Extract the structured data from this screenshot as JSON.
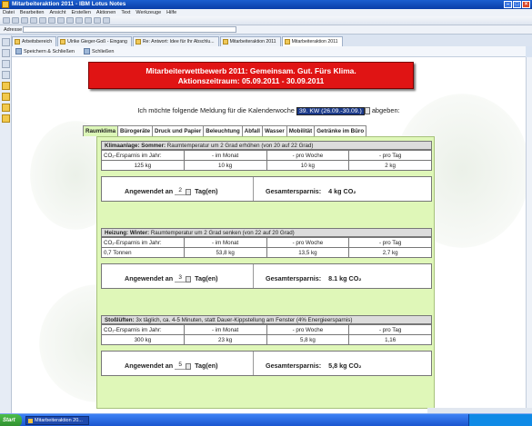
{
  "window": {
    "title": "Mitarbeiteraktion 2011 - IBM Lotus Notes"
  },
  "menu": [
    "Datei",
    "Bearbeiten",
    "Ansicht",
    "Erstellen",
    "Aktionen",
    "Text",
    "Werkzeuge",
    "Hilfe"
  ],
  "address": {
    "label": "Adresse"
  },
  "tabs": [
    {
      "label": "Arbeitsbereich"
    },
    {
      "label": "Ulrike Gieger-Goß - Eingang"
    },
    {
      "label": "Re: Antwort: Idee für Ihr Abschlu..."
    },
    {
      "label": "Mitarbeiteraktion 2011"
    },
    {
      "label": "Mitarbeiteraktion 2011"
    }
  ],
  "actions": {
    "save_close": "Speichern & Schließen",
    "close": "Schließen"
  },
  "banner": {
    "line1": "Mitarbeiterwettbewerb 2011: Gemeinsam. Gut. Fürs Klima.",
    "line2": "Aktionszeitraum: 05.09.2011 - 30.09.2011"
  },
  "week": {
    "prefix": "Ich möchte folgende Meldung für die Kalenderwoche",
    "selected": "39. KW (26.09.-30.09.)",
    "suffix": "abgeben:"
  },
  "categories": [
    "Raumklima",
    "Bürogeräte",
    "Druck und Papier",
    "Beleuchtung",
    "Abfall",
    "Wasser",
    "Mobilität",
    "Getränke im Büro"
  ],
  "sections": [
    {
      "title": "Klimaanlage: Sommer:",
      "desc": "Raumtemperatur um 2 Grad erhöhen (von 20 auf 22 Grad)",
      "row1": [
        "CO₂-Ersparnis im Jahr:",
        "- im Monat",
        "- pro Woche",
        "- pro Tag"
      ],
      "row2": [
        "125 kg",
        "10 kg",
        "10 kg",
        "2 kg"
      ],
      "applied_label": "Angewendet an",
      "days": "2",
      "days_unit": "Tag(en)",
      "total_label": "Gesamtersparnis:",
      "total": "4 kg CO₂"
    },
    {
      "title": "Heizung: Winter:",
      "desc": "Raumtemperatur um 2 Grad senken (von 22 auf 20 Grad)",
      "row1": [
        "CO₂-Ersparnis im Jahr:",
        "- im Monat",
        "- pro Woche",
        "- pro Tag"
      ],
      "row2": [
        "0,7 Tonnen",
        "53,8 kg",
        "13,5 kg",
        "2,7 kg"
      ],
      "applied_label": "Angewendet an",
      "days": "3",
      "days_unit": "Tag(en)",
      "total_label": "Gesamtersparnis:",
      "total": "8.1 kg CO₂"
    },
    {
      "title": "Stoßlüften:",
      "desc": "3x täglich, ca. 4-5 Minuten, statt Dauer-Kippstellung am Fenster (4% Energieersparnis)",
      "row1": [
        "CO₂-Ersparnis im Jahr:",
        "- im Monat",
        "- pro Woche",
        "- pro Tag"
      ],
      "row2": [
        "300 kg",
        "23 kg",
        "5,8 kg",
        "1,16"
      ],
      "applied_label": "Angewendet an",
      "days": "5",
      "days_unit": "Tag(en)",
      "total_label": "Gesamtersparnis:",
      "total": "5,8 kg CO₂"
    }
  ],
  "taskbar": {
    "start": "Start",
    "task": "Mitarbeiteraktion 20..."
  }
}
